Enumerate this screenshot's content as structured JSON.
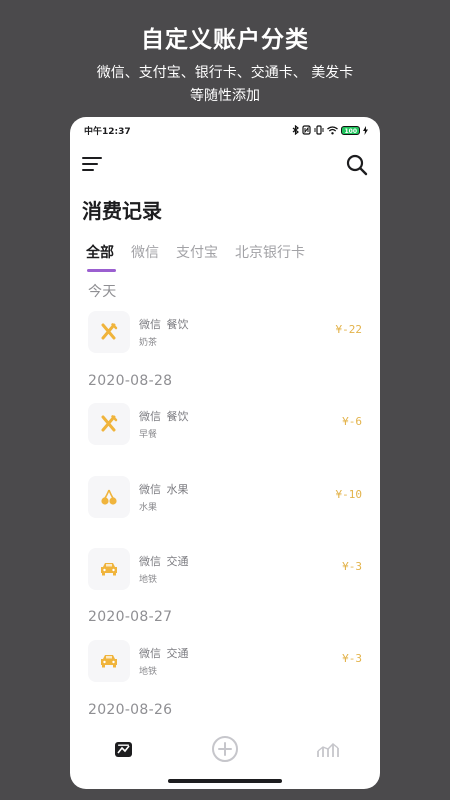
{
  "promo": {
    "title": "自定义账户分类",
    "subtitle_line1": "微信、支付宝、银行卡、交通卡、 美发卡",
    "subtitle_line2": "等随性添加"
  },
  "status_bar": {
    "time": "中午12:37",
    "battery": "100"
  },
  "header": {
    "menu_icon": "menu-icon",
    "search_icon": "search-icon"
  },
  "page": {
    "title": "消费记录"
  },
  "tabs": [
    {
      "label": "全部",
      "active": true
    },
    {
      "label": "微信",
      "active": false
    },
    {
      "label": "支付宝",
      "active": false
    },
    {
      "label": "北京银行卡",
      "active": false
    }
  ],
  "groups": [
    {
      "date": "今天",
      "items": [
        {
          "icon": "utensils-icon",
          "account": "微信",
          "category": "餐饮",
          "note": "奶茶",
          "amount": "¥-22"
        }
      ]
    },
    {
      "date": "2020-08-28",
      "items": [
        {
          "icon": "utensils-icon",
          "account": "微信",
          "category": "餐饮",
          "note": "早餐",
          "amount": "¥-6"
        },
        {
          "icon": "cherry-icon",
          "account": "微信",
          "category": "水果",
          "note": "水果",
          "amount": "¥-10"
        },
        {
          "icon": "car-icon",
          "account": "微信",
          "category": "交通",
          "note": "地铁",
          "amount": "¥-3"
        }
      ]
    },
    {
      "date": "2020-08-27",
      "items": [
        {
          "icon": "car-icon",
          "account": "微信",
          "category": "交通",
          "note": "地铁",
          "amount": "¥-3"
        }
      ]
    },
    {
      "date": "2020-08-26",
      "items": []
    }
  ],
  "bottom_nav": [
    {
      "icon": "records-icon",
      "active": true
    },
    {
      "icon": "add-circle-icon",
      "active": false
    },
    {
      "icon": "chart-icon",
      "active": false
    }
  ],
  "colors": {
    "accent": "#9b5fd0",
    "amount": "#e3b34b",
    "icon": "#f0b43c",
    "background": "#4b4a4c"
  }
}
